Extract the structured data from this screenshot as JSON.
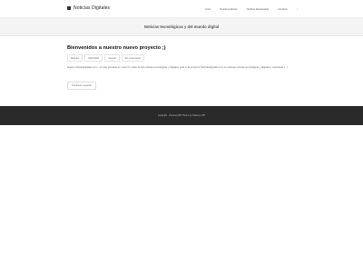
{
  "header": {
    "brand_prefix": "▪",
    "brand_title": "Noticias Digitales",
    "nav": [
      "Inicio",
      "Nuestra Historia",
      "Noticias Destacadas",
      "Contacto"
    ],
    "search_glyph": "⌕"
  },
  "banner": {
    "title": "Noticias tecnológicas y del mundo digital"
  },
  "post": {
    "title": "Bienvenidos a nuestro nuevo proyecto ;)",
    "meta": [
      "Maneleu",
      "04/07/2023",
      "General",
      "Sin comentarios"
    ],
    "excerpt": "Nuevo noticiasdigitales.com - un sitio pensado en reunir lo mejor de las noticias tecnológicas y digitales para ti. El proyecto Noticiasdigitales.com se entrega noticias tecnológicas y digitales, mostrando [...]",
    "read_more": "Continuar Leyendo"
  },
  "footer": {
    "text": "Copyright · Powered WP Theme by Kadence WP"
  }
}
